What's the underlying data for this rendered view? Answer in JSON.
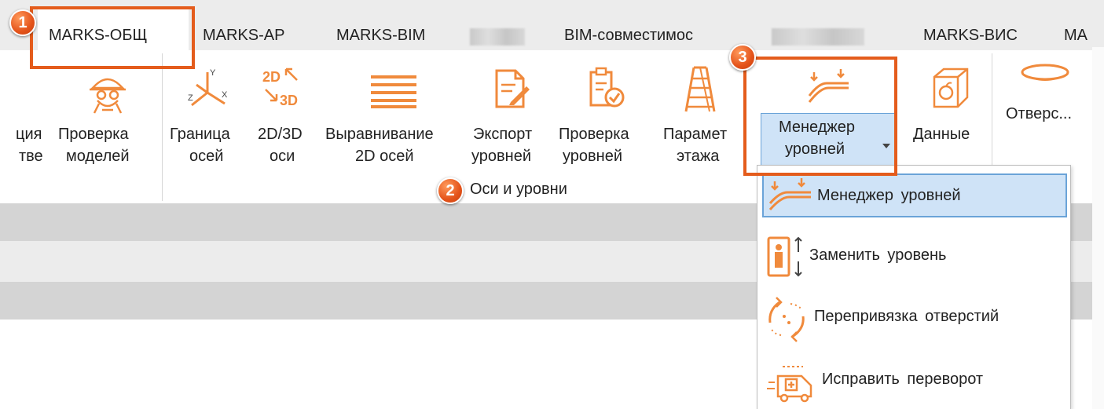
{
  "tabs": {
    "marks_obsh": "MARKS-ОБЩ",
    "marks_ar": "MARKS-АР",
    "marks_bim": "MARKS-BIM",
    "bim_compat": "BIM-совместимос",
    "marks_vis": "MARKS-ВИС",
    "marks_cut": "MA"
  },
  "ribbon": {
    "col0": {
      "line1": "ция",
      "line2": "тве"
    },
    "check_models": {
      "line1": "Проверка",
      "line2": "моделей"
    },
    "axis_border": {
      "line1": "Граница",
      "line2": "осей"
    },
    "axes_2d3d": {
      "line1": "2D/3D",
      "line2": "оси"
    },
    "align_axes": {
      "line1": "Выравнивание",
      "line2": "2D осей"
    },
    "export_levels": {
      "line1": "Экспорт",
      "line2": "уровней"
    },
    "check_levels": {
      "line1": "Проверка",
      "line2": "уровней"
    },
    "floor_params": {
      "line1": "Парамет",
      "line2": "этажа"
    },
    "level_manager": {
      "line1": "Менеджер",
      "line2": "уровней"
    },
    "data": {
      "label": "Данные"
    },
    "openings": {
      "label": "Отверс..."
    },
    "group_caption": "Оси и уровни",
    "icon_2d3d_top": "2D",
    "icon_2d3d_bottom": "3D"
  },
  "dropdown": {
    "items": [
      {
        "label": "Менеджер уровней",
        "icon": "level-manager-icon"
      },
      {
        "label": "Заменить уровень",
        "icon": "replace-level-icon"
      },
      {
        "label": "Перепривязка отверстий",
        "icon": "rebind-openings-icon"
      },
      {
        "label": "Исправить переворот",
        "icon": "fix-flip-icon"
      }
    ]
  },
  "callouts": {
    "one": "1",
    "two": "2",
    "three": "3"
  },
  "colors": {
    "accent": "#e45c1c",
    "icon_orange": "#f08a3c",
    "selection": "#cfe3f7",
    "selection_border": "#6aa3d8"
  }
}
